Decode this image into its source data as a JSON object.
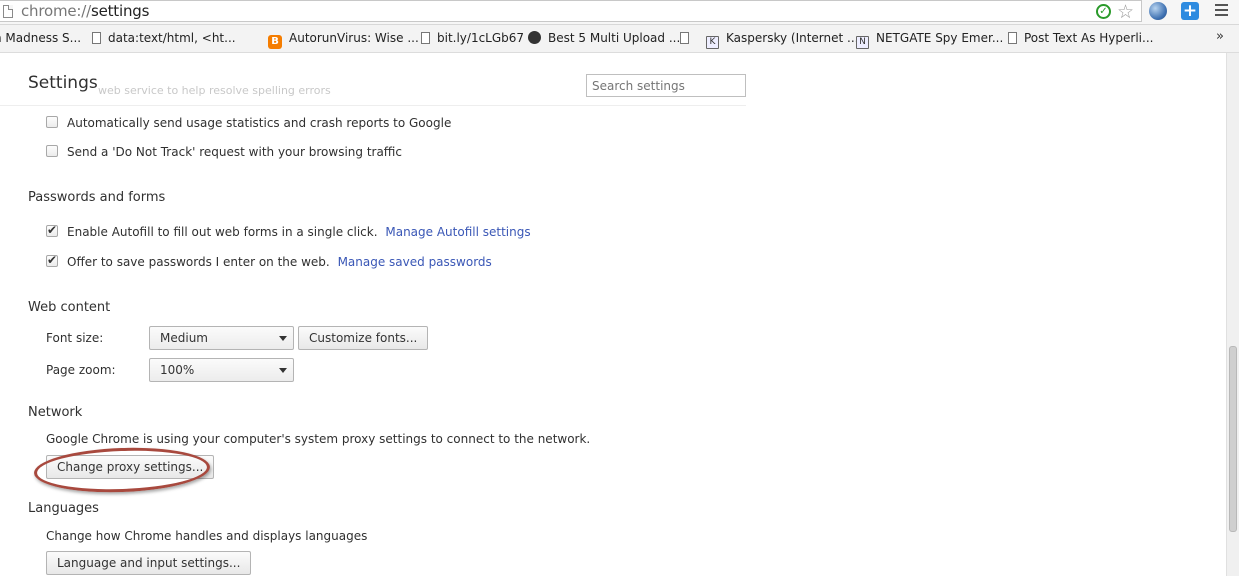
{
  "omnibox": {
    "url_scheme": "chrome://",
    "url_path": "settings"
  },
  "bookmarks": [
    {
      "label": "n Madness S...",
      "icon": "page-icon"
    },
    {
      "label": "data:text/html, <ht...",
      "icon": "page-icon"
    },
    {
      "label": "AutorunVirus: Wise ...",
      "icon": "blogger-icon"
    },
    {
      "label": "bit.ly/1cLGb67",
      "icon": "page-icon"
    },
    {
      "label": "Best 5 Multi Upload ...",
      "icon": "github-icon"
    },
    {
      "label": "",
      "icon": "page-icon"
    },
    {
      "label": "Kaspersky (Internet ...",
      "icon": "doc-icon"
    },
    {
      "label": "NETGATE Spy Emer...",
      "icon": "doc-icon"
    },
    {
      "label": "Post Text As Hyperli...",
      "icon": "page-icon"
    }
  ],
  "bookmarks_more": "»",
  "settings": {
    "title": "Settings",
    "search_placeholder": "Search settings",
    "ghost_text": "web service to help resolve spelling errors",
    "privacy": {
      "usage_stats": "Automatically send usage statistics and crash reports to Google",
      "do_not_track": "Send a 'Do Not Track' request with your browsing traffic"
    },
    "passwords": {
      "title": "Passwords and forms",
      "autofill": "Enable Autofill to fill out web forms in a single click.",
      "autofill_link": "Manage Autofill settings",
      "save_passwords": "Offer to save passwords I enter on the web.",
      "save_passwords_link": "Manage saved passwords"
    },
    "web_content": {
      "title": "Web content",
      "font_size_label": "Font size:",
      "font_size_value": "Medium",
      "customize_fonts": "Customize fonts...",
      "page_zoom_label": "Page zoom:",
      "page_zoom_value": "100%"
    },
    "network": {
      "title": "Network",
      "description": "Google Chrome is using your computer's system proxy settings to connect to the network.",
      "change_proxy": "Change proxy settings..."
    },
    "languages": {
      "title": "Languages",
      "description": "Change how Chrome handles and displays languages",
      "button": "Language and input settings..."
    }
  },
  "colors": {
    "link": "#3a57b6",
    "highlight": "#a8493e"
  }
}
